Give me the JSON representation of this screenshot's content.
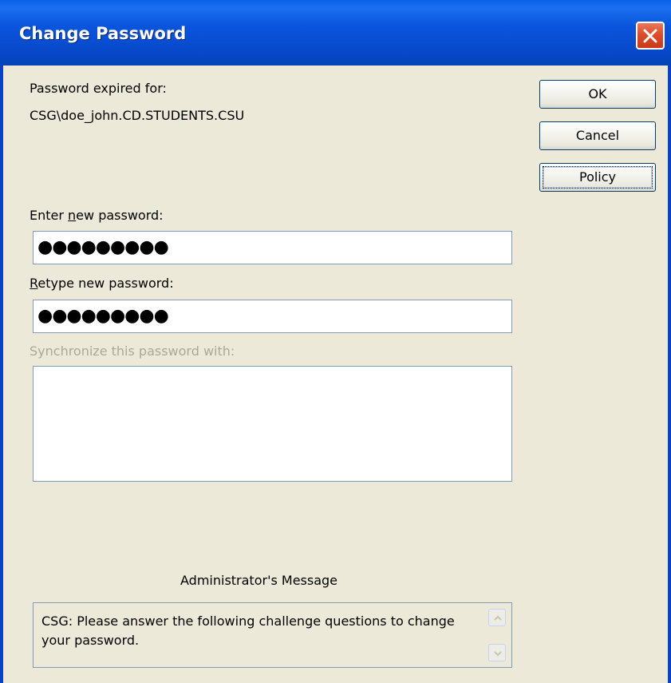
{
  "window": {
    "title": "Change Password"
  },
  "info": {
    "expired_label": "Password expired for:",
    "account": "CSG\\doe_john.CD.STUDENTS.CSU"
  },
  "buttons": {
    "ok": "OK",
    "cancel": "Cancel",
    "policy": "Policy"
  },
  "new_password": {
    "label_prefix": "Enter ",
    "label_accel": "n",
    "label_suffix": "ew password:",
    "masked_value": "●●●●●●●●●"
  },
  "retype_password": {
    "label_accel": "R",
    "label_suffix": "etype new password:",
    "masked_value": "●●●●●●●●●"
  },
  "sync": {
    "label": "Synchronize this password with:",
    "items": []
  },
  "admin_message": {
    "heading": "Administrator's Message",
    "text": "CSG: Please answer the following challenge questions to change your password."
  },
  "icons": {
    "close": "close-icon",
    "scroll_up": "chevron-up-icon",
    "scroll_down": "chevron-down-icon"
  },
  "colors": {
    "titlebar": "#0a55dd",
    "close_button": "#dd4d2b",
    "dialog_background": "#ece9d8",
    "disabled_text": "#aca899",
    "field_border": "#7f9db9"
  }
}
